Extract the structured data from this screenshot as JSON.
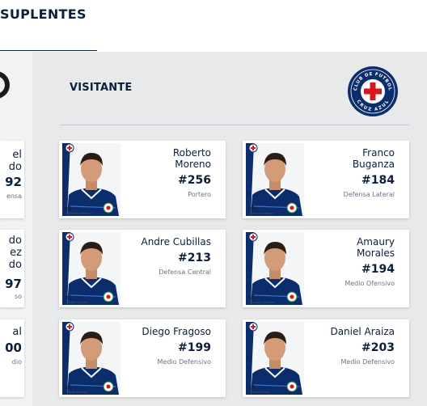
{
  "header": {
    "title": "SUPLENTES"
  },
  "left_team": {
    "cards": [
      {
        "name": "el\ndo",
        "number": "92",
        "position": "ensa"
      },
      {
        "name": "do\nez\ndo",
        "number": "97",
        "position": "so"
      },
      {
        "name": "al",
        "number": "00",
        "position": "dio"
      }
    ]
  },
  "visitor": {
    "title": "VISITANTE",
    "logo_text_top": "CLUB DE FUTBOL",
    "logo_text_bottom": "CRUZ AZUL",
    "colors": {
      "navy": "#0b2d6b",
      "red": "#d7161e",
      "text": "#0b1f3a"
    },
    "players": [
      {
        "name": "Roberto\nMoreno",
        "number": "#256",
        "position": "Portero",
        "caption_num": "256",
        "caption": "Roberto Moreno"
      },
      {
        "name": "Franco\nBuganza",
        "number": "#184",
        "position": "Defensa Lateral",
        "caption_num": "184",
        "caption": "Franco Buganza"
      },
      {
        "name": "Andre Cubillas",
        "number": "#213",
        "position": "Defensa Central",
        "caption_num": "213",
        "caption": "Andre Cubillas"
      },
      {
        "name": "Amaury\nMorales",
        "number": "#194",
        "position": "Medio Ofensivo",
        "caption_num": "194",
        "caption": "Amaury Morales"
      },
      {
        "name": "Diego Fragoso",
        "number": "#199",
        "position": "Medio Defensivo",
        "caption_num": "199",
        "caption": "Diego Fragoso"
      },
      {
        "name": "Daniel Araiza",
        "number": "#203",
        "position": "Medio Defensivo",
        "caption_num": "203",
        "caption": "Daniel Araiza"
      }
    ]
  }
}
